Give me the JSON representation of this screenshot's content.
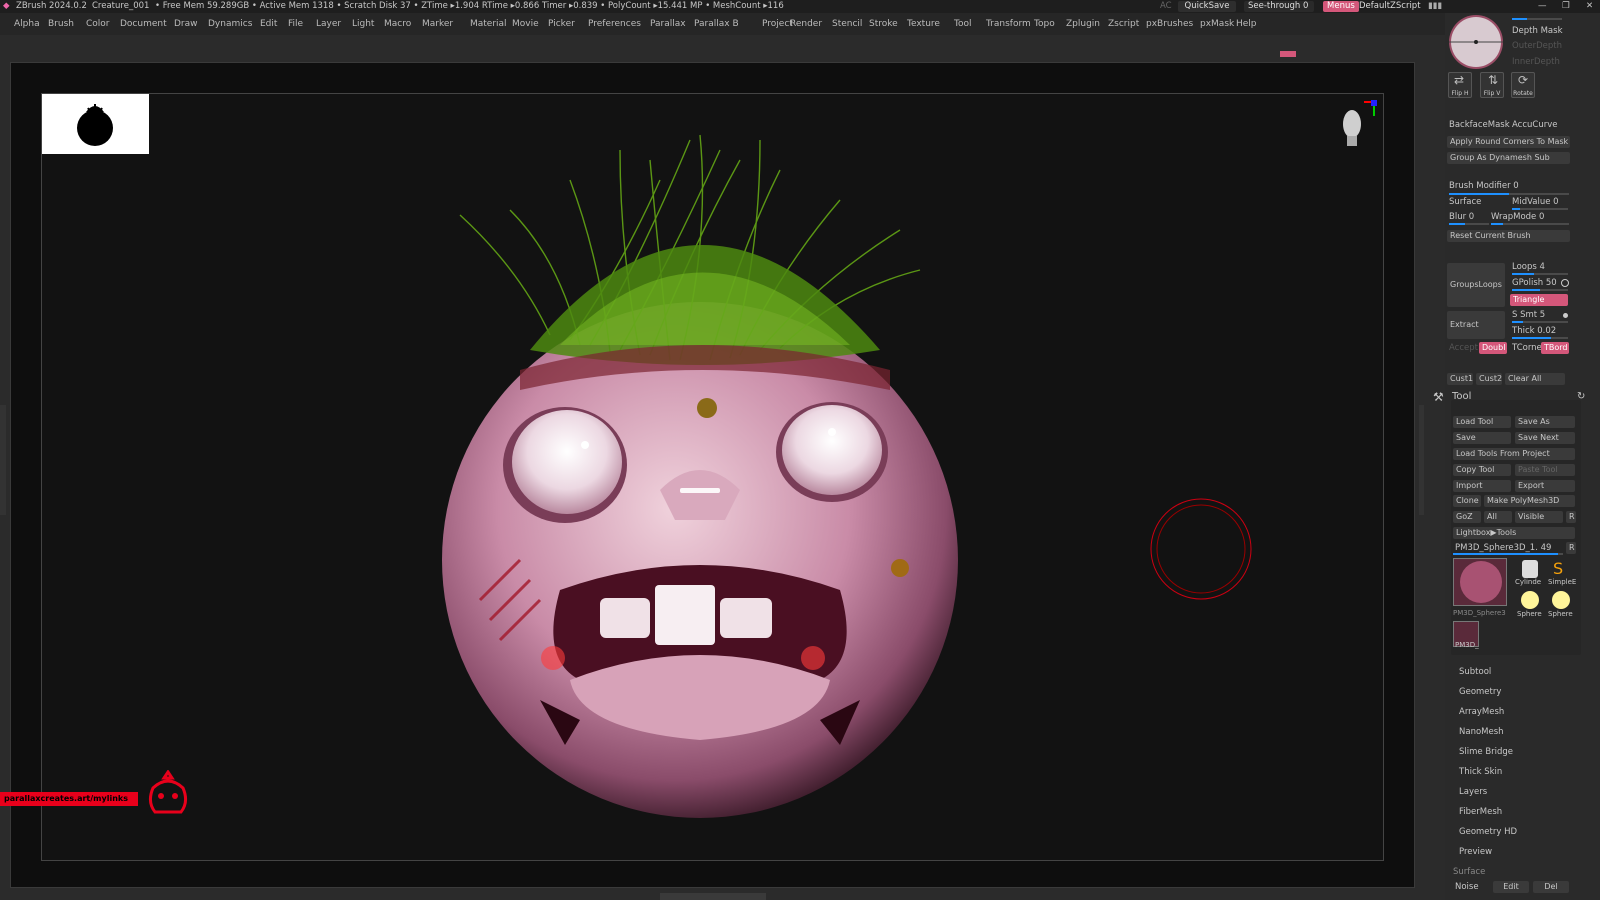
{
  "titlebar": {
    "app": "ZBrush 2024.0.2",
    "project": "Creature_001",
    "stats": "• Free Mem 59.289GB • Active Mem 1318 • Scratch Disk 37 • ZTime ▸1.904 RTime ▸0.866 Timer ▸0.839 • PolyCount ▸15.441 MP • MeshCount ▸116",
    "ac": "AC",
    "quicksave": "QuickSave",
    "see_through": "See-through  0",
    "menus": "Menus",
    "default_zscript": "DefaultZScript"
  },
  "menus": [
    "Alpha",
    "Brush",
    "Color",
    "Document",
    "Draw",
    "Dynamics",
    "Edit",
    "File",
    "Layer",
    "Light",
    "Macro",
    "Marker",
    "Material",
    "Movie",
    "Picker",
    "Preferences",
    "Parallax",
    "Parallax B",
    "Project",
    "Render",
    "Stencil",
    "Stroke",
    "Texture",
    "Tool",
    "Transform",
    "Topo",
    "Zplugin",
    "Zscript",
    "pxBrushes",
    "pxMask",
    "Help"
  ],
  "panel": {
    "depth_mask": "Depth Mask",
    "outer_depth": "OuterDepth",
    "inner_depth": "InnerDepth",
    "flip_h": "Flip H",
    "flip_v": "Flip V",
    "rotate": "Rotate",
    "backface_mask": "BackfaceMask",
    "accucurve": "AccuCurve",
    "apply_round": "Apply Round Corners To Mask",
    "group_dynamesh": "Group As Dynamesh Sub",
    "brush_modifier": "Brush Modifier 0",
    "surface": "Surface",
    "midvalue": "MidValue 0",
    "blur": "Blur 0",
    "wrapmode": "WrapMode 0",
    "reset_brush": "Reset Current Brush",
    "groups_loops": "GroupsLoops",
    "loops": "Loops 4",
    "gpolish": "GPolish 50",
    "triangle": "Triangle",
    "extract": "Extract",
    "ssmt": "S Smt 5",
    "thick": "Thick 0.02",
    "accept": "Accept",
    "double": "Doubl",
    "tcorne": "TCorne",
    "tbord": "TBord",
    "cust1": "Cust1",
    "cust2": "Cust2",
    "clear_all": "Clear All",
    "tool_title": "Tool",
    "load_tool": "Load Tool",
    "save_as": "Save As",
    "save": "Save",
    "save_next": "Save Next",
    "load_from_project": "Load Tools From Project",
    "copy_tool": "Copy Tool",
    "paste_tool": "Paste Tool",
    "import": "Import",
    "export": "Export",
    "clone": "Clone",
    "make_polymesh": "Make PolyMesh3D",
    "goz": "GoZ",
    "all": "All",
    "visible": "Visible",
    "r": "R",
    "lightbox_tools": "Lightbox▶Tools",
    "current_tool": "PM3D_Sphere3D_1. 49",
    "thumb_labels": [
      "PM3D_Sphere3",
      "Cylinde",
      "SimpleE",
      "Sphere",
      "Sphere",
      "PM3D_"
    ],
    "submenus": [
      "Subtool",
      "Geometry",
      "ArrayMesh",
      "NanoMesh",
      "Slime Bridge",
      "Thick Skin",
      "Layers",
      "FiberMesh",
      "Geometry HD",
      "Preview",
      "Surface"
    ],
    "noise": "Noise",
    "edit": "Edit",
    "del": "Del"
  },
  "canvas": {
    "link": "parallaxcreates.art/mylinks"
  },
  "colors": {
    "accent_blue": "#1e90ff",
    "accent_red": "#d4577a",
    "hair_green": "#5f9e15"
  }
}
